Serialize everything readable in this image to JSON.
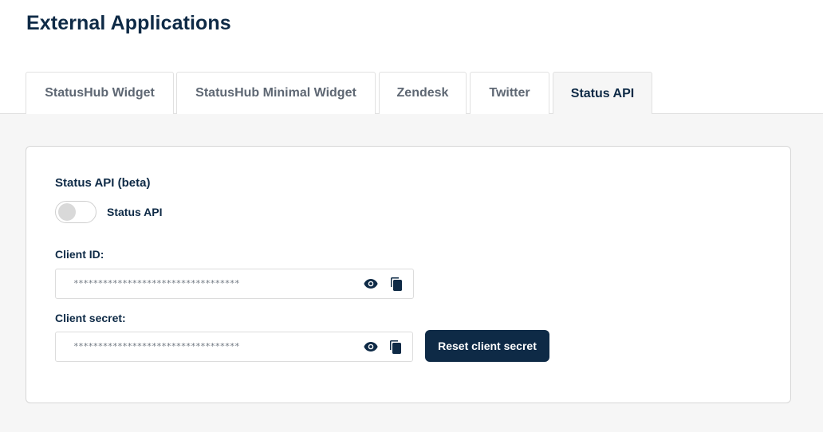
{
  "page": {
    "title": "External Applications"
  },
  "tabs": [
    {
      "label": "StatusHub Widget",
      "active": false
    },
    {
      "label": "StatusHub Minimal Widget",
      "active": false
    },
    {
      "label": "Zendesk",
      "active": false
    },
    {
      "label": "Twitter",
      "active": false
    },
    {
      "label": "Status API",
      "active": true
    }
  ],
  "status_api": {
    "section_title": "Status API (beta)",
    "toggle_label": "Status API",
    "toggle_enabled": false,
    "client_id": {
      "label": "Client ID:",
      "value": "**********************************",
      "show_icon": "eye-icon",
      "copy_icon": "copy-icon"
    },
    "client_secret": {
      "label": "Client secret:",
      "value": "**********************************",
      "show_icon": "eye-icon",
      "copy_icon": "copy-icon"
    },
    "reset_button_label": "Reset client secret"
  },
  "colors": {
    "primary": "#0e2a46",
    "background": "#f6f6f6",
    "tab_inactive_text": "#5e6773"
  }
}
